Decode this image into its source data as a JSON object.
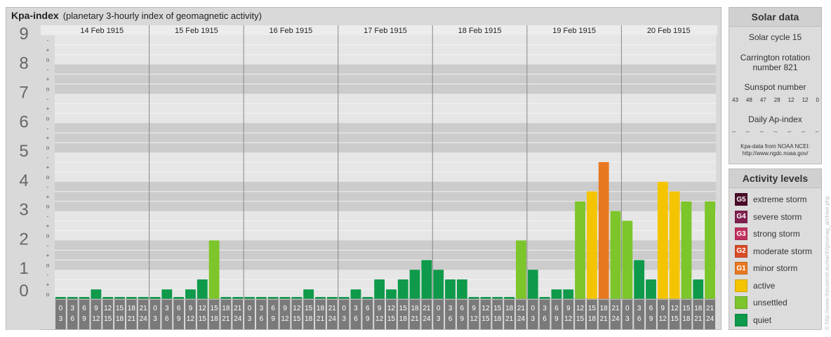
{
  "header": {
    "title": "Kpa-index",
    "subtitle": "(planetary 3-hourly index of geomagnetic activity)"
  },
  "chart_data": {
    "type": "bar",
    "days": [
      "14 Feb 1915",
      "15 Feb 1915",
      "16 Feb 1915",
      "17 Feb 1915",
      "18 Feb 1915",
      "19 Feb 1915",
      "20 Feb 1915"
    ],
    "interval_starts": [
      "0",
      "3",
      "6",
      "9",
      "12",
      "15",
      "18",
      "21"
    ],
    "interval_ends": [
      "3",
      "6",
      "9",
      "12",
      "15",
      "18",
      "21",
      "24"
    ],
    "ylim": [
      0,
      9
    ],
    "y_ticks": [
      "0",
      "1",
      "2",
      "3",
      "4",
      "5",
      "6",
      "7",
      "8",
      "9"
    ],
    "sub_ticks": [
      "-",
      "o",
      "+"
    ],
    "values": [
      [
        0,
        0,
        0,
        0.33,
        0,
        0,
        0,
        0
      ],
      [
        0,
        0.33,
        0,
        0.33,
        0.67,
        2,
        0,
        0
      ],
      [
        0,
        0,
        0,
        0,
        0,
        0.33,
        0,
        0
      ],
      [
        0,
        0.33,
        0,
        0.67,
        0.33,
        0.67,
        1,
        1.33
      ],
      [
        1,
        0.67,
        0.67,
        0,
        0,
        0,
        0,
        2
      ],
      [
        1,
        0,
        0.33,
        0.33,
        3.33,
        3.67,
        4.67,
        3
      ],
      [
        2.67,
        1.33,
        0.67,
        4,
        3.67,
        3.33,
        0.67,
        3.33
      ]
    ],
    "colors": {
      "quiet": "#0e9a4a",
      "unsettled": "#7cc52a",
      "active": "#f5c400",
      "G1": "#e87820",
      "G2": "#d94c28",
      "G3": "#c0305c",
      "G4": "#80204e",
      "G5": "#4a0a28"
    }
  },
  "solar": {
    "title": "Solar data",
    "cycle": "Solar cycle 15",
    "carrington_1": "Carrington rotation",
    "carrington_2": "number 821",
    "sunspot_label": "Sunspot number",
    "sunspots": [
      "43",
      "48",
      "47",
      "28",
      "12",
      "12",
      "0"
    ],
    "ap_label": "Daily Ap-index",
    "ap_values": [
      "--",
      "--",
      "--",
      "--",
      "--",
      "--",
      "--"
    ],
    "note_1": "Kpa-data from NOAA NCEI:",
    "note_2": "http://www.ngdc.noaa.gov/"
  },
  "activity": {
    "title": "Activity levels",
    "items": [
      {
        "badge": "G5",
        "label": "extreme storm",
        "color": "#4a0a28"
      },
      {
        "badge": "G4",
        "label": "severe storm",
        "color": "#80204e"
      },
      {
        "badge": "G3",
        "label": "strong storm",
        "color": "#c0305c"
      },
      {
        "badge": "G2",
        "label": "moderate storm",
        "color": "#d94c28"
      },
      {
        "badge": "G1",
        "label": "minor storm",
        "color": "#e87820"
      },
      {
        "badge": "",
        "label": "active",
        "color": "#f5c400"
      },
      {
        "badge": "",
        "label": "unsettled",
        "color": "#7cc52a"
      },
      {
        "badge": "",
        "label": "quiet",
        "color": "#0e9a4a"
      }
    ]
  },
  "credit": "© http://www.theusenet.eu/earth/geomag_archive.php"
}
